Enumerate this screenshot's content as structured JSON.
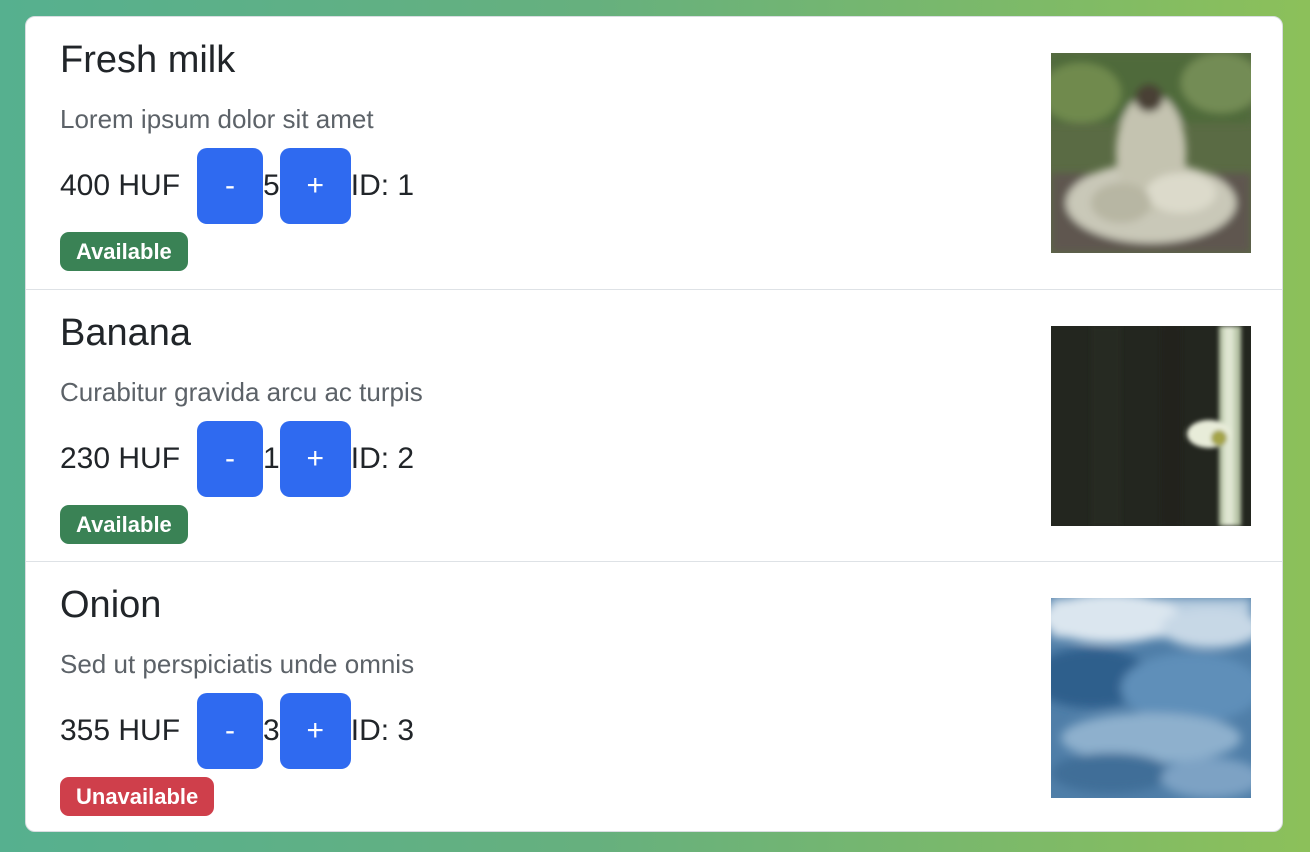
{
  "products": [
    {
      "name": "Fresh milk",
      "description": "Lorem ipsum dolor sit amet",
      "price": "400 HUF",
      "minus_label": "-",
      "quantity": "5",
      "plus_label": "+",
      "id_text": "ID: 1",
      "status": "Available",
      "status_color": "#3a8255"
    },
    {
      "name": "Banana",
      "description": "Curabitur gravida arcu ac turpis",
      "price": "230 HUF",
      "minus_label": "-",
      "quantity": "1",
      "plus_label": "+",
      "id_text": "ID: 2",
      "status": "Available",
      "status_color": "#3a8255"
    },
    {
      "name": "Onion",
      "description": "Sed ut perspiciatis unde omnis",
      "price": "355 HUF",
      "minus_label": "-",
      "quantity": "3",
      "plus_label": "+",
      "id_text": "ID: 3",
      "status": "Unavailable",
      "status_color": "#cf3f4b"
    }
  ],
  "colors": {
    "button": "#2f6af0",
    "available": "#3a8255",
    "unavailable": "#cf3f4b"
  }
}
